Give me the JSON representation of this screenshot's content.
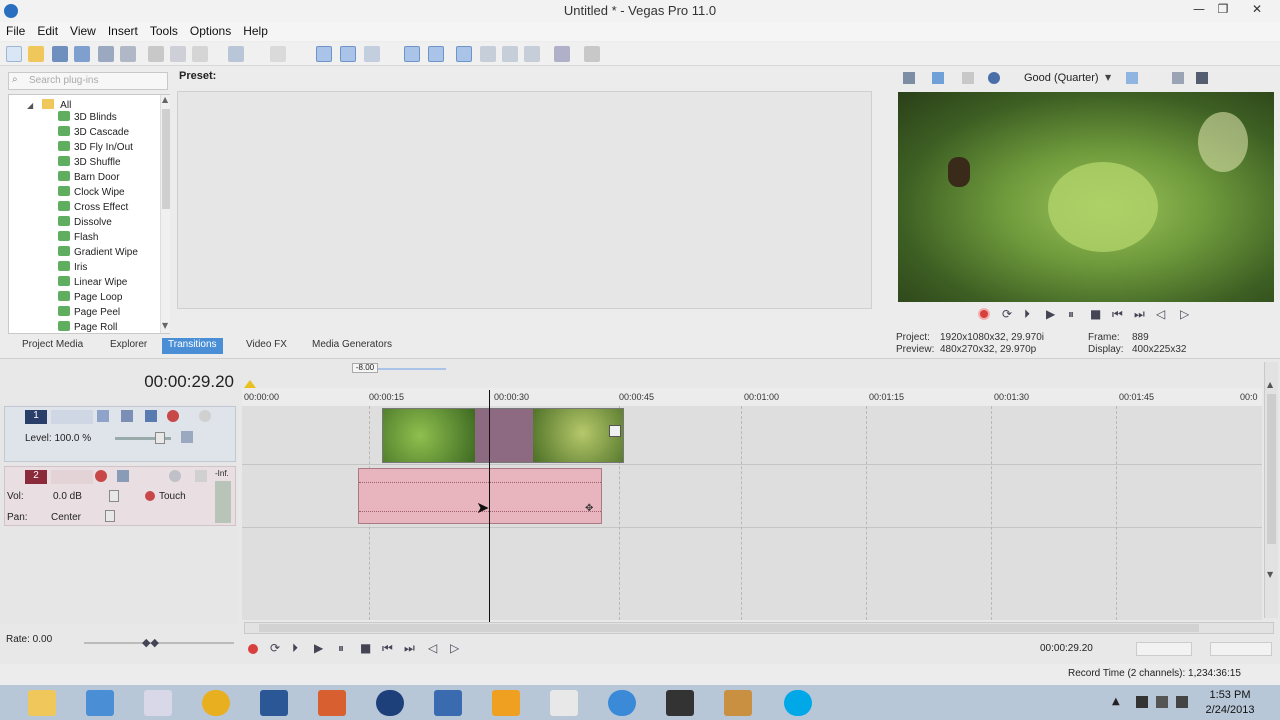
{
  "window": {
    "title": "Untitled * - Vegas Pro 11.0",
    "minimize_label": "—",
    "restore_label": "❐",
    "close_label": "✕"
  },
  "menu": [
    "File",
    "Edit",
    "View",
    "Insert",
    "Tools",
    "Options",
    "Help"
  ],
  "plugin_panel": {
    "search_placeholder": "Search plug-ins",
    "tree_root": "All",
    "items": [
      "3D Blinds",
      "3D Cascade",
      "3D Fly In/Out",
      "3D Shuffle",
      "Barn Door",
      "Clock Wipe",
      "Cross Effect",
      "Dissolve",
      "Flash",
      "Gradient Wipe",
      "Iris",
      "Linear Wipe",
      "Page Loop",
      "Page Peel",
      "Page Roll"
    ],
    "preset_label": "Preset:",
    "tabs": [
      "Project Media",
      "Explorer",
      "Transitions",
      "Video FX",
      "Media Generators"
    ],
    "active_tab": "Transitions"
  },
  "video_preview": {
    "quality": "Good (Quarter)",
    "project_label": "Project:",
    "project_value": "1920x1080x32, 29.970i",
    "preview_label": "Preview:",
    "preview_value": "480x270x32, 29.970p",
    "frame_label": "Frame:",
    "frame_value": "889",
    "display_label": "Display:",
    "display_value": "400x225x32"
  },
  "timeline": {
    "timecode": "00:00:29.20",
    "marker": "-8.00",
    "ruler": [
      "00:00:00",
      "00:00:15",
      "00:00:30",
      "00:00:45",
      "00:01:00",
      "00:01:15",
      "00:01:30",
      "00:01:45",
      "00:0"
    ],
    "track1": {
      "number": "1",
      "level": "Level: 100.0 %"
    },
    "track2": {
      "number": "2",
      "vol_label": "Vol:",
      "vol_value": "0.0 dB",
      "touch": "Touch",
      "pan_label": "Pan:",
      "pan_value": "Center",
      "meter_label": "-Inf."
    },
    "rate": "Rate: 0.00",
    "bottom_timecode": "00:00:29.20",
    "record_time": "Record Time (2 channels): 1,234:36:15"
  },
  "taskbar": {
    "time": "1:53 PM",
    "date": "2/24/2013"
  }
}
